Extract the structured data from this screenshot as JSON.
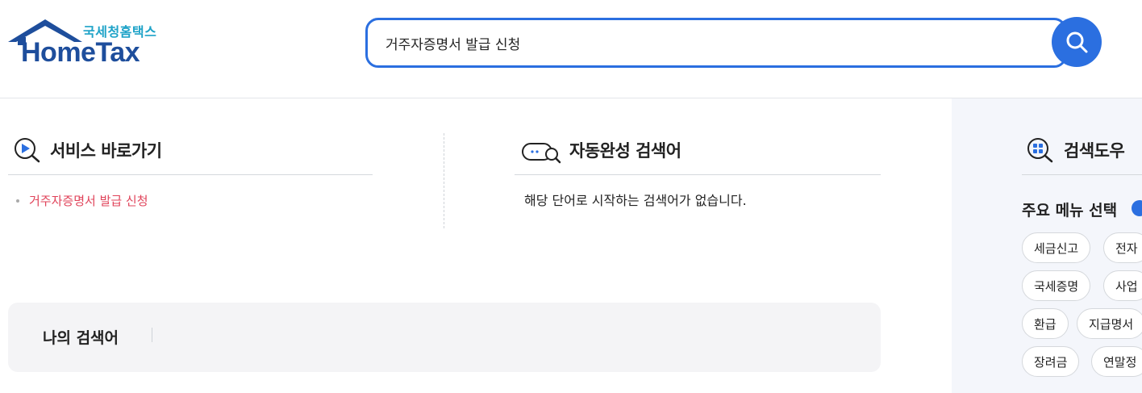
{
  "logo": {
    "korean": "국세청홈택스",
    "english": "HomeTax"
  },
  "search": {
    "value": "거주자증명서 발급 신청"
  },
  "service_shortcut": {
    "title": "서비스 바로가기",
    "items": [
      "거주자증명서 발급 신청"
    ]
  },
  "autocomplete": {
    "title": "자동완성 검색어",
    "message": "해당 단어로 시작하는 검색어가 없습니다."
  },
  "my_search": {
    "label": "나의 검색어"
  },
  "search_helper": {
    "title": "검색도우",
    "menu_title": "주요 메뉴 선택",
    "chips": [
      "세금신고",
      "전자",
      "국세증명",
      "사업",
      "환급",
      "지급명서",
      "장려금",
      "연말정"
    ]
  },
  "colors": {
    "accent": "#2b6fe0",
    "link_red": "#e0435a",
    "logo_blue": "#1e4e9c",
    "logo_teal": "#1fa3c8",
    "panel_bg": "#f4f6fb"
  }
}
